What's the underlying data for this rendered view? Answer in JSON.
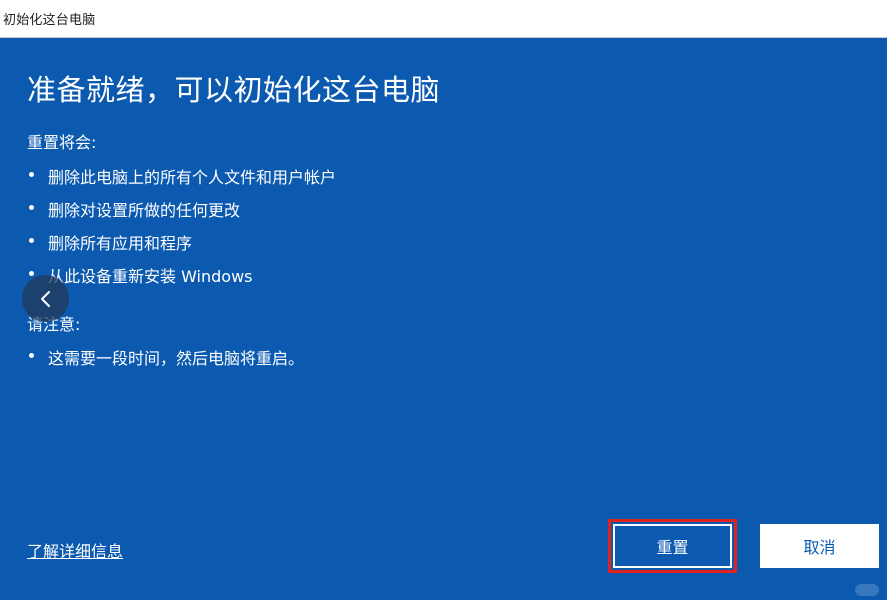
{
  "window": {
    "title": "初始化这台电脑"
  },
  "main": {
    "heading": "准备就绪，可以初始化这台电脑",
    "reset_section": {
      "label": "重置将会:",
      "items": [
        "删除此电脑上的所有个人文件和用户帐户",
        "删除对设置所做的任何更改",
        "删除所有应用和程序",
        "从此设备重新安装 Windows"
      ]
    },
    "note_section": {
      "label": "请注意:",
      "items": [
        "这需要一段时间，然后电脑将重启。"
      ]
    },
    "learn_more_link": "了解详细信息",
    "back_icon": "chevron-left-icon"
  },
  "buttons": {
    "reset_label": "重置",
    "cancel_label": "取消"
  },
  "colors": {
    "background": "#0b5ab0",
    "highlight": "#e0231e"
  }
}
